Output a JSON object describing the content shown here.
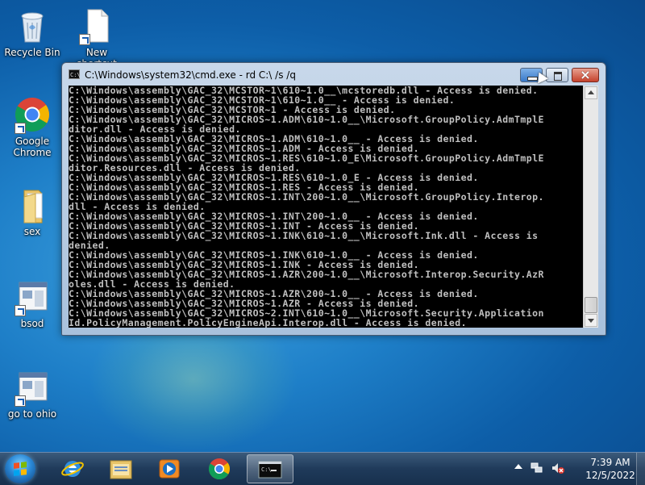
{
  "desktop": {
    "icons": [
      {
        "label": "Recycle Bin"
      },
      {
        "label": "New shortcut"
      },
      {
        "label": "Google Chrome"
      },
      {
        "label": "sex"
      },
      {
        "label": "bsod"
      },
      {
        "label": "go to ohio"
      }
    ]
  },
  "window": {
    "title": "C:\\Windows\\system32\\cmd.exe - rd  C:\\ /s /q",
    "icon_text": "C:\\"
  },
  "console": {
    "lines": [
      "C:\\Windows\\assembly\\GAC_32\\MCSTOR~1\\610~1.0__\\mcstoredb.dll - Access is denied.",
      "C:\\Windows\\assembly\\GAC_32\\MCSTOR~1\\610~1.0__ - Access is denied.",
      "C:\\Windows\\assembly\\GAC_32\\MCSTOR~1 - Access is denied.",
      "C:\\Windows\\assembly\\GAC_32\\MICROS~1.ADM\\610~1.0__\\Microsoft.GroupPolicy.AdmTmplE",
      "ditor.dll - Access is denied.",
      "C:\\Windows\\assembly\\GAC_32\\MICROS~1.ADM\\610~1.0__ - Access is denied.",
      "C:\\Windows\\assembly\\GAC_32\\MICROS~1.ADM - Access is denied.",
      "C:\\Windows\\assembly\\GAC_32\\MICROS~1.RES\\610~1.0_E\\Microsoft.GroupPolicy.AdmTmplE",
      "ditor.Resources.dll - Access is denied.",
      "C:\\Windows\\assembly\\GAC_32\\MICROS~1.RES\\610~1.0_E - Access is denied.",
      "C:\\Windows\\assembly\\GAC_32\\MICROS~1.RES - Access is denied.",
      "C:\\Windows\\assembly\\GAC_32\\MICROS~1.INT\\200~1.0__\\Microsoft.GroupPolicy.Interop.",
      "dll - Access is denied.",
      "C:\\Windows\\assembly\\GAC_32\\MICROS~1.INT\\200~1.0__ - Access is denied.",
      "C:\\Windows\\assembly\\GAC_32\\MICROS~1.INT - Access is denied.",
      "C:\\Windows\\assembly\\GAC_32\\MICROS~1.INK\\610~1.0__\\Microsoft.Ink.dll - Access is",
      "denied.",
      "C:\\Windows\\assembly\\GAC_32\\MICROS~1.INK\\610~1.0__ - Access is denied.",
      "C:\\Windows\\assembly\\GAC_32\\MICROS~1.INK - Access is denied.",
      "C:\\Windows\\assembly\\GAC_32\\MICROS~1.AZR\\200~1.0__\\Microsoft.Interop.Security.AzR",
      "oles.dll - Access is denied.",
      "C:\\Windows\\assembly\\GAC_32\\MICROS~1.AZR\\200~1.0__ - Access is denied.",
      "C:\\Windows\\assembly\\GAC_32\\MICROS~1.AZR - Access is denied.",
      "C:\\Windows\\assembly\\GAC_32\\MICROS~2.INT\\610~1.0__\\Microsoft.Security.Application",
      "Id.PolicyManagement.PolicyEngineApi.Interop.dll - Access is denied."
    ]
  },
  "taskbar": {
    "clock_time": "7:39 AM",
    "clock_date": "12/5/2022",
    "items": [
      "internet-explorer",
      "windows-explorer",
      "windows-media-player",
      "google-chrome",
      "command-prompt"
    ]
  }
}
